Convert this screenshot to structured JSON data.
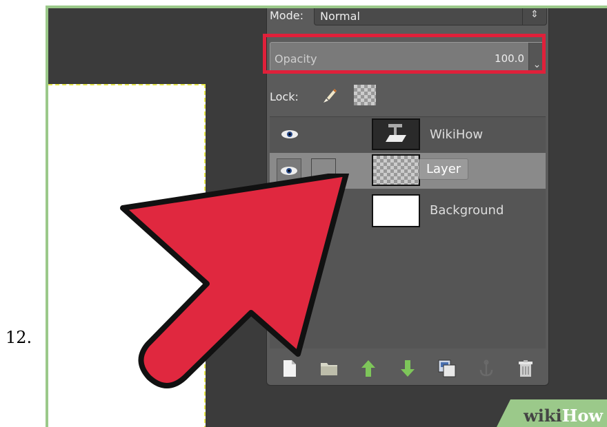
{
  "step_number": "12.",
  "panel": {
    "mode_label": "Mode:",
    "mode_value": "Normal",
    "opacity_label": "Opacity",
    "opacity_value": "100.0",
    "lock_label": "Lock:"
  },
  "layers": [
    {
      "name": "WikiHow",
      "visible": true,
      "selected": false,
      "thumbnail": "text-layer-icon"
    },
    {
      "name": "Layer",
      "visible": true,
      "selected": true,
      "thumbnail": "transparent-checker"
    },
    {
      "name": "Background",
      "visible": false,
      "selected": false,
      "thumbnail": "white"
    }
  ],
  "toolbar_icons": [
    "new-layer-icon",
    "new-group-icon",
    "raise-layer-icon",
    "lower-layer-icon",
    "duplicate-layer-icon",
    "anchor-icon",
    "delete-layer-icon"
  ],
  "watermark": {
    "part1": "wiki",
    "part2": "How"
  },
  "colors": {
    "highlight": "#e0203a",
    "arrow": "#e0283f",
    "frame": "#9bc98a"
  }
}
